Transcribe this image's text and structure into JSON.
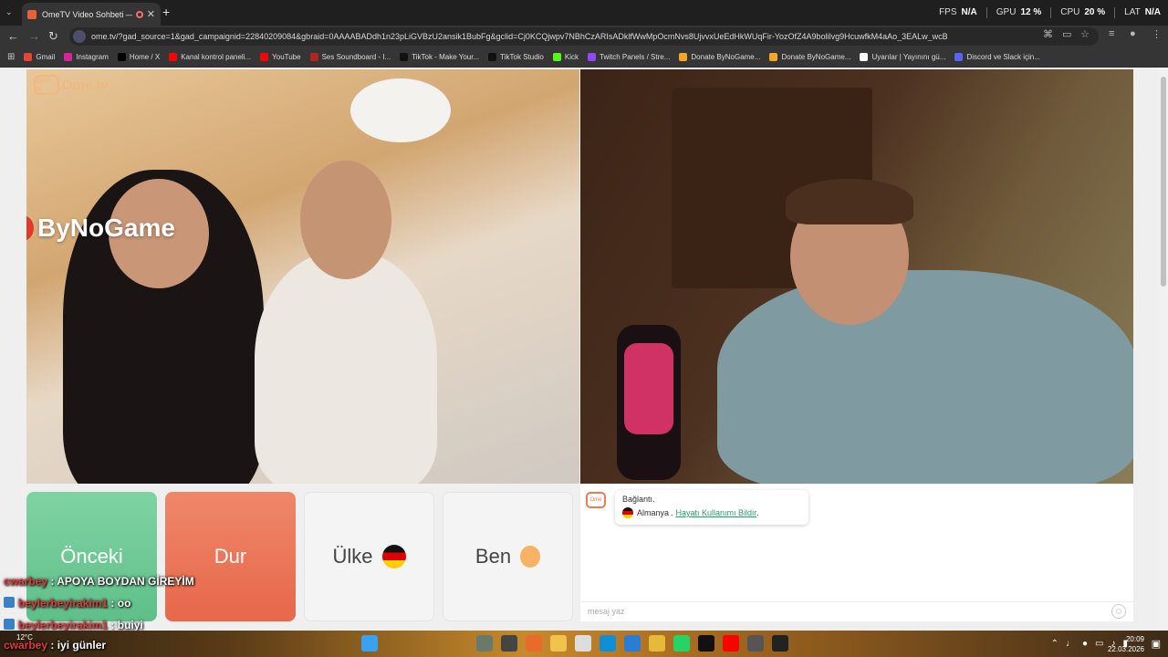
{
  "browser": {
    "tab_title": "OmeTV Video Sohbeti — O",
    "url": "ome.tv/?gad_source=1&gad_campaignid=22840209084&gbraid=0AAAABADdh1n23pLiGVBzU2ansik1BubFg&gclid=Cj0KCQjwpv7NBhCzARIsADklfWwMpOcmNvs8UjvvxUeEdHkWUqFir-YozOfZ4A9bolilvg9HcuwfkM4aAo_3EALw_wcB",
    "stats": {
      "fps_label": "FPS",
      "fps_value": "N/A",
      "gpu_label": "GPU",
      "gpu_value": "12 %",
      "cpu_label": "CPU",
      "cpu_value": "20 %",
      "lat_label": "LAT",
      "lat_value": "N/A"
    },
    "bookmarks": [
      {
        "label": "Gmail",
        "color": "#ea4335"
      },
      {
        "label": "Instagram",
        "color": "#d6249f"
      },
      {
        "label": "Home / X",
        "color": "#000000"
      },
      {
        "label": "Kanal kontrol paneli...",
        "color": "#ff0000"
      },
      {
        "label": "YouTube",
        "color": "#ff0000"
      },
      {
        "label": "Ses Soundboard - I...",
        "color": "#b3261e"
      },
      {
        "label": "TikTok - Make Your...",
        "color": "#111111"
      },
      {
        "label": "TikTok Studio",
        "color": "#111111"
      },
      {
        "label": "Kick",
        "color": "#53fc18"
      },
      {
        "label": "Twitch Panels / Stre...",
        "color": "#9146ff"
      },
      {
        "label": "Donate ByNoGame...",
        "color": "#f5a623"
      },
      {
        "label": "Donate ByNoGame...",
        "color": "#f5a623"
      },
      {
        "label": "Uyarılar | Yayınını gü...",
        "color": "#ffffff"
      },
      {
        "label": "Discord ve Slack için...",
        "color": "#5865f2"
      }
    ]
  },
  "page": {
    "logo_text": "Ome.tv",
    "logo_badge": "Ome tv",
    "watermark": "ByNoGame",
    "buttons": {
      "previous": "Önceki",
      "stop": "Dur",
      "country": "Ülke",
      "me": "Ben"
    },
    "chat": {
      "connected": "Bağlantı.",
      "country": "Almanya",
      "separator": ".",
      "report_link": "Hayatı Kullanımı Bildir",
      "input_placeholder": "mesaj yaz",
      "emoji_icon": "☺"
    }
  },
  "overlay_chat": [
    {
      "user": "cwarbey",
      "message": ": APOYA BOYDAN GİREYİM",
      "badge": false
    },
    {
      "user": "beylerbeyirakim1",
      "message": ": oo",
      "badge": true
    },
    {
      "user": "beylerbeyirakim1",
      "message": ": buiyi",
      "badge": true
    },
    {
      "user": "cwarbey",
      "message": ": iyi günler",
      "badge": false
    }
  ],
  "taskbar": {
    "temperature": "12°C",
    "time": "20:09",
    "date": "22.03.2026"
  }
}
